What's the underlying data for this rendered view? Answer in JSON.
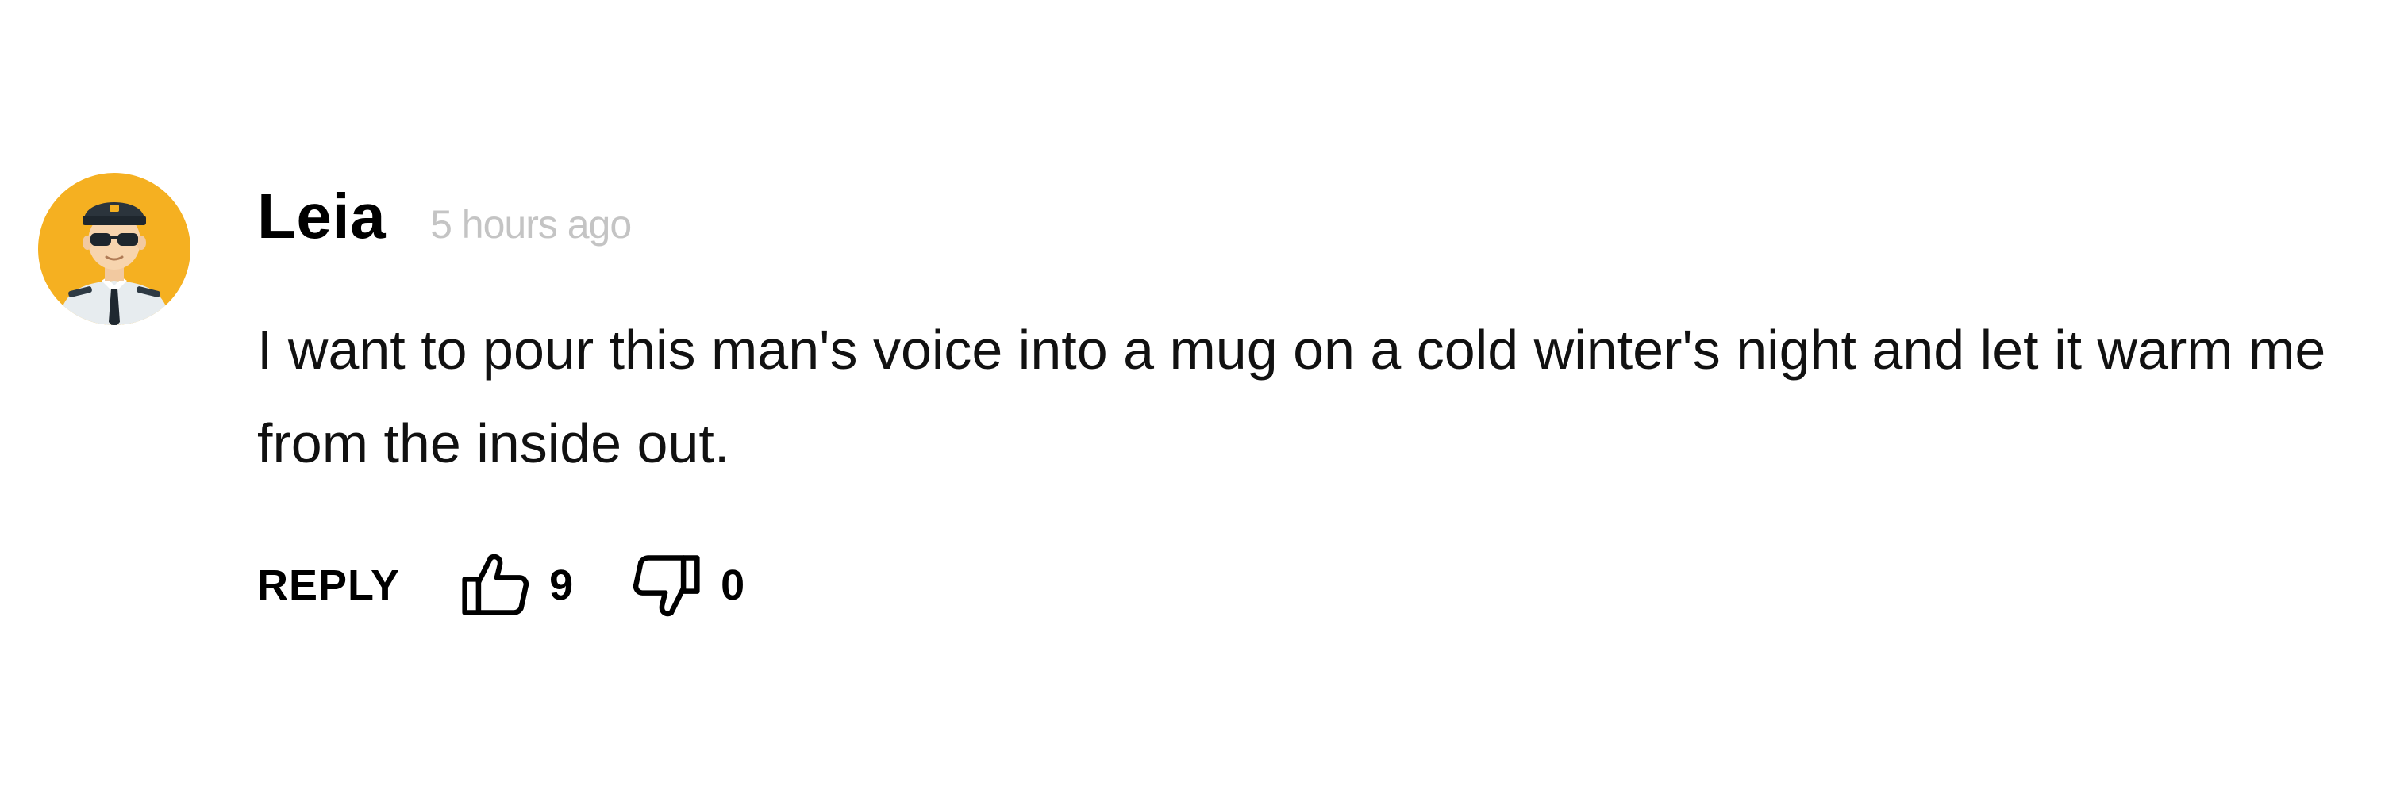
{
  "comment": {
    "author": "Leia",
    "timestamp": "5 hours ago",
    "text": "I want to pour this man's voice into a mug on a cold winter's night and let it warm me from the inside out.",
    "avatar_icon": "pilot-avatar-icon",
    "avatar_color": "#F5B021"
  },
  "actions": {
    "reply_label": "REPLY",
    "like_count": "9",
    "dislike_count": "0",
    "like_icon": "thumbs-up-icon",
    "dislike_icon": "thumbs-down-icon"
  }
}
